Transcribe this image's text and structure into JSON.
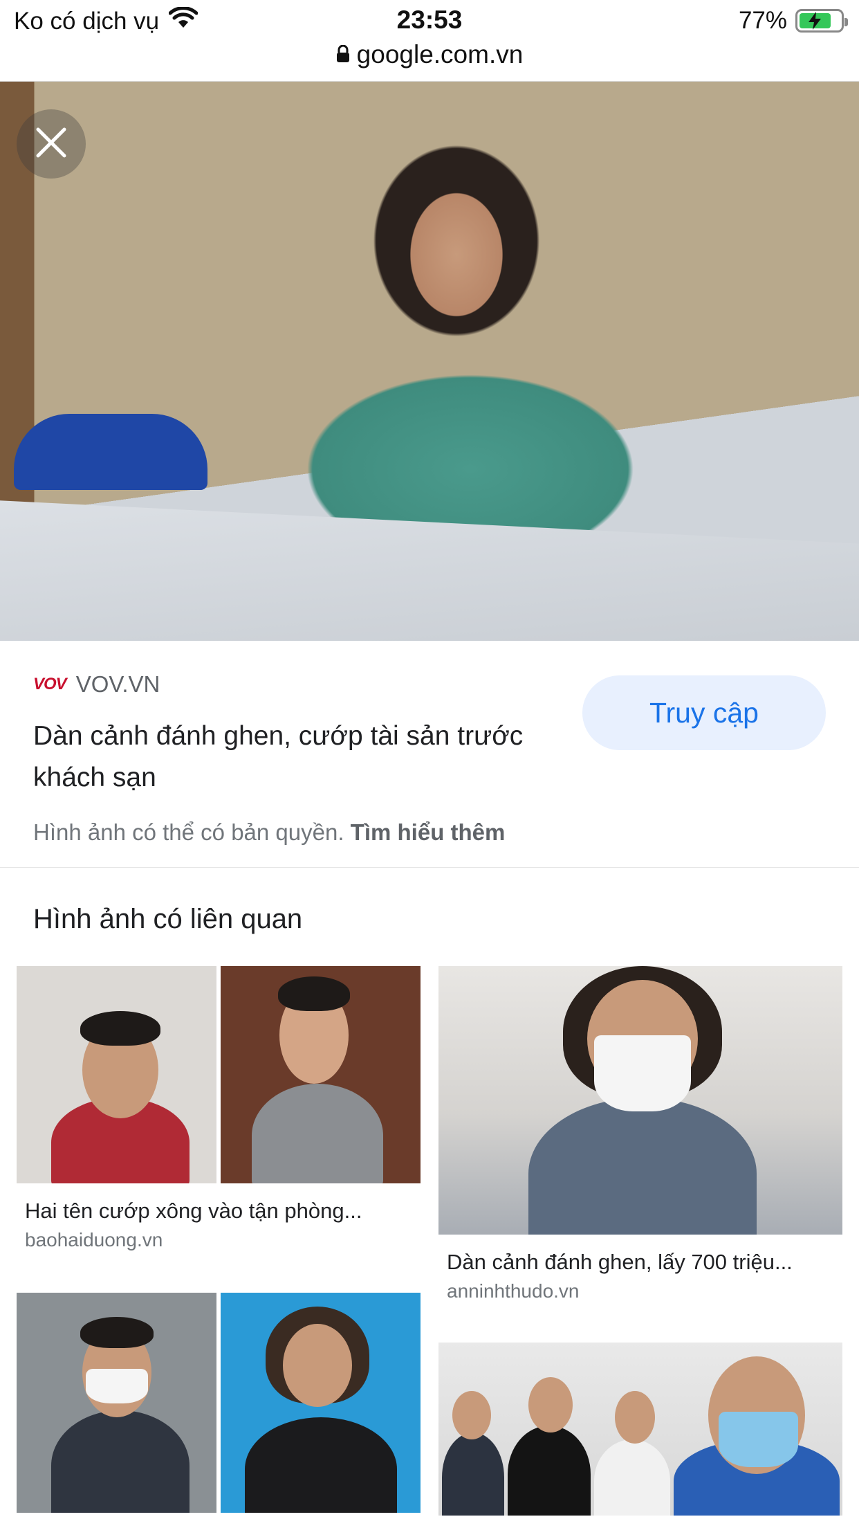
{
  "status_bar": {
    "carrier": "Ko có dịch vụ",
    "time": "23:53",
    "battery": "77%",
    "url": "google.com.vn"
  },
  "viewer": {
    "source_logo": "VOV",
    "source_name": "VOV.VN",
    "title": "Dàn cảnh đánh ghen, cướp tài sản trước khách sạn",
    "visit_label": "Truy cập",
    "copyright_text": "Hình ảnh có thể có bản quyền.",
    "learn_more": "Tìm hiểu thêm"
  },
  "related": {
    "heading": "Hình ảnh có liên quan",
    "items": [
      {
        "caption": "Hai tên cướp xông vào tận phòng...",
        "source": "baohaiduong.vn"
      },
      {
        "caption": "Dàn cảnh đánh ghen, lấy 700 triệu...",
        "source": "anninhthudo.vn"
      },
      {
        "caption": "",
        "source": ""
      },
      {
        "caption": "",
        "source": ""
      }
    ]
  },
  "icons": {
    "wifi": "wifi-icon",
    "lock": "lock-icon",
    "battery": "battery-charging-icon",
    "close": "close-icon"
  },
  "colors": {
    "accent": "#1a73e8",
    "visit_bg": "#e8f0fe",
    "battery_green": "#34c759"
  }
}
